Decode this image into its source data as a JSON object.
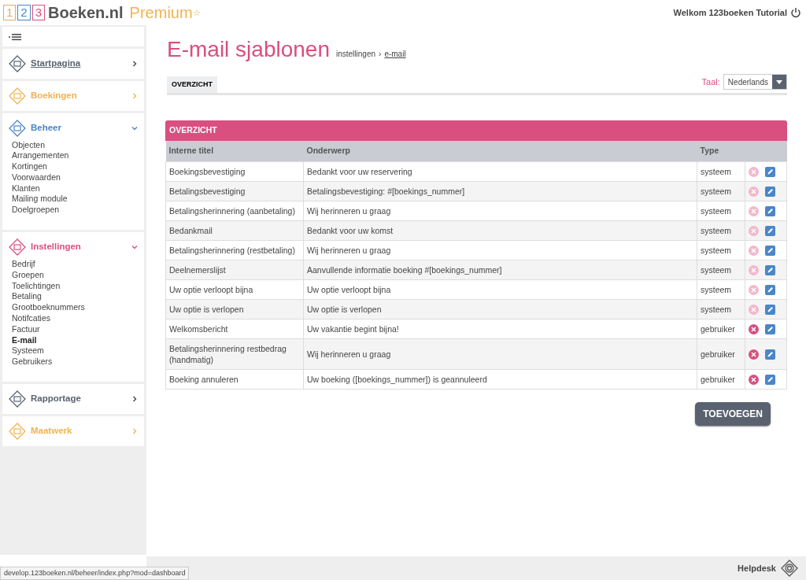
{
  "logo": {
    "digits": [
      "1",
      "2",
      "3"
    ],
    "name": "Boeken.nl",
    "edition": "Premium",
    "star": "☆"
  },
  "header": {
    "welcome": "Welkom 123boeken Tutorial"
  },
  "sidebar": {
    "sections": [
      {
        "label": "Startpagina",
        "color": "#5a6270",
        "expanded": false
      },
      {
        "label": "Boekingen",
        "color": "#f0b350",
        "expanded": false
      },
      {
        "label": "Beheer",
        "color": "#4a86c8",
        "expanded": true,
        "items": [
          {
            "label": "Objecten",
            "selected": false
          },
          {
            "label": "Arrangementen",
            "selected": false
          },
          {
            "label": "Kortingen",
            "selected": false
          },
          {
            "label": "Voorwaarden",
            "selected": false
          },
          {
            "label": "Klanten",
            "selected": false
          },
          {
            "label": "Mailing module",
            "selected": false
          },
          {
            "label": "Doelgroepen",
            "selected": false
          }
        ]
      },
      {
        "label": "Instellingen",
        "color": "#d94f7f",
        "expanded": true,
        "items": [
          {
            "label": "Bedrijf",
            "selected": false
          },
          {
            "label": "Groepen",
            "selected": false
          },
          {
            "label": "Toelichtingen",
            "selected": false
          },
          {
            "label": "Betaling",
            "selected": false
          },
          {
            "label": "Grootboeknummers",
            "selected": false
          },
          {
            "label": "Notifcaties",
            "selected": false
          },
          {
            "label": "Factuur",
            "selected": false
          },
          {
            "label": "E-mail",
            "selected": true
          },
          {
            "label": "Systeem",
            "selected": false
          },
          {
            "label": "Gebruikers",
            "selected": false
          }
        ]
      },
      {
        "label": "Rapportage",
        "color": "#5a6270",
        "expanded": false
      },
      {
        "label": "Maatwerk",
        "color": "#f0b350",
        "expanded": false
      }
    ]
  },
  "page": {
    "title": "E-mail sjablonen",
    "breadcrumb": [
      "instellingen",
      "e-mail"
    ],
    "breadcrumb_separator": "›"
  },
  "tabs": [
    {
      "label": "OVERZICHT",
      "selected": true
    }
  ],
  "language": {
    "label": "Taal:",
    "value": "Nederlands"
  },
  "table": {
    "title": "OVERZICHT",
    "columns": [
      "Interne titel",
      "Onderwerp",
      "Type"
    ],
    "rows": [
      {
        "title": "Boekingsbevestiging",
        "subject": "Bedankt voor uw reservering",
        "type": "systeem",
        "delete_disabled": true
      },
      {
        "title": "Betalingsbevestiging",
        "subject": "Betalingsbevestiging: #[boekings_nummer]",
        "type": "systeem",
        "delete_disabled": true
      },
      {
        "title": "Betalingsherinnering (aanbetaling)",
        "subject": "Wij herinneren u graag",
        "type": "systeem",
        "delete_disabled": true
      },
      {
        "title": "Bedankmail",
        "subject": "Bedankt voor uw komst",
        "type": "systeem",
        "delete_disabled": true
      },
      {
        "title": "Betalingsherinnering (restbetaling)",
        "subject": "Wij herinneren u graag",
        "type": "systeem",
        "delete_disabled": true
      },
      {
        "title": "Deelnemerslijst",
        "subject": "Aanvullende informatie boeking #[boekings_nummer]",
        "type": "systeem",
        "delete_disabled": true
      },
      {
        "title": "Uw optie verloopt bijna",
        "subject": "Uw optie verloopt bijna",
        "type": "systeem",
        "delete_disabled": true
      },
      {
        "title": "Uw optie is verlopen",
        "subject": "Uw optie is verlopen",
        "type": "systeem",
        "delete_disabled": true
      },
      {
        "title": "Welkomsbericht",
        "subject": "Uw vakantie begint bijna!",
        "type": "gebruiker",
        "delete_disabled": false
      },
      {
        "title": "Betalingsherinnering restbedrag (handmatig)",
        "subject": "Wij herinneren u graag",
        "type": "gebruiker",
        "delete_disabled": false
      },
      {
        "title": "Boeking annuleren",
        "subject": "Uw boeking ([boekings_nummer]) is geannuleerd",
        "type": "gebruiker",
        "delete_disabled": false
      }
    ]
  },
  "add_button": "TOEVOEGEN",
  "footer": {
    "helpdesk": "Helpdesk"
  },
  "status_url": "develop.123boeken.nl/beheer/index.php?mod=dashboard"
}
